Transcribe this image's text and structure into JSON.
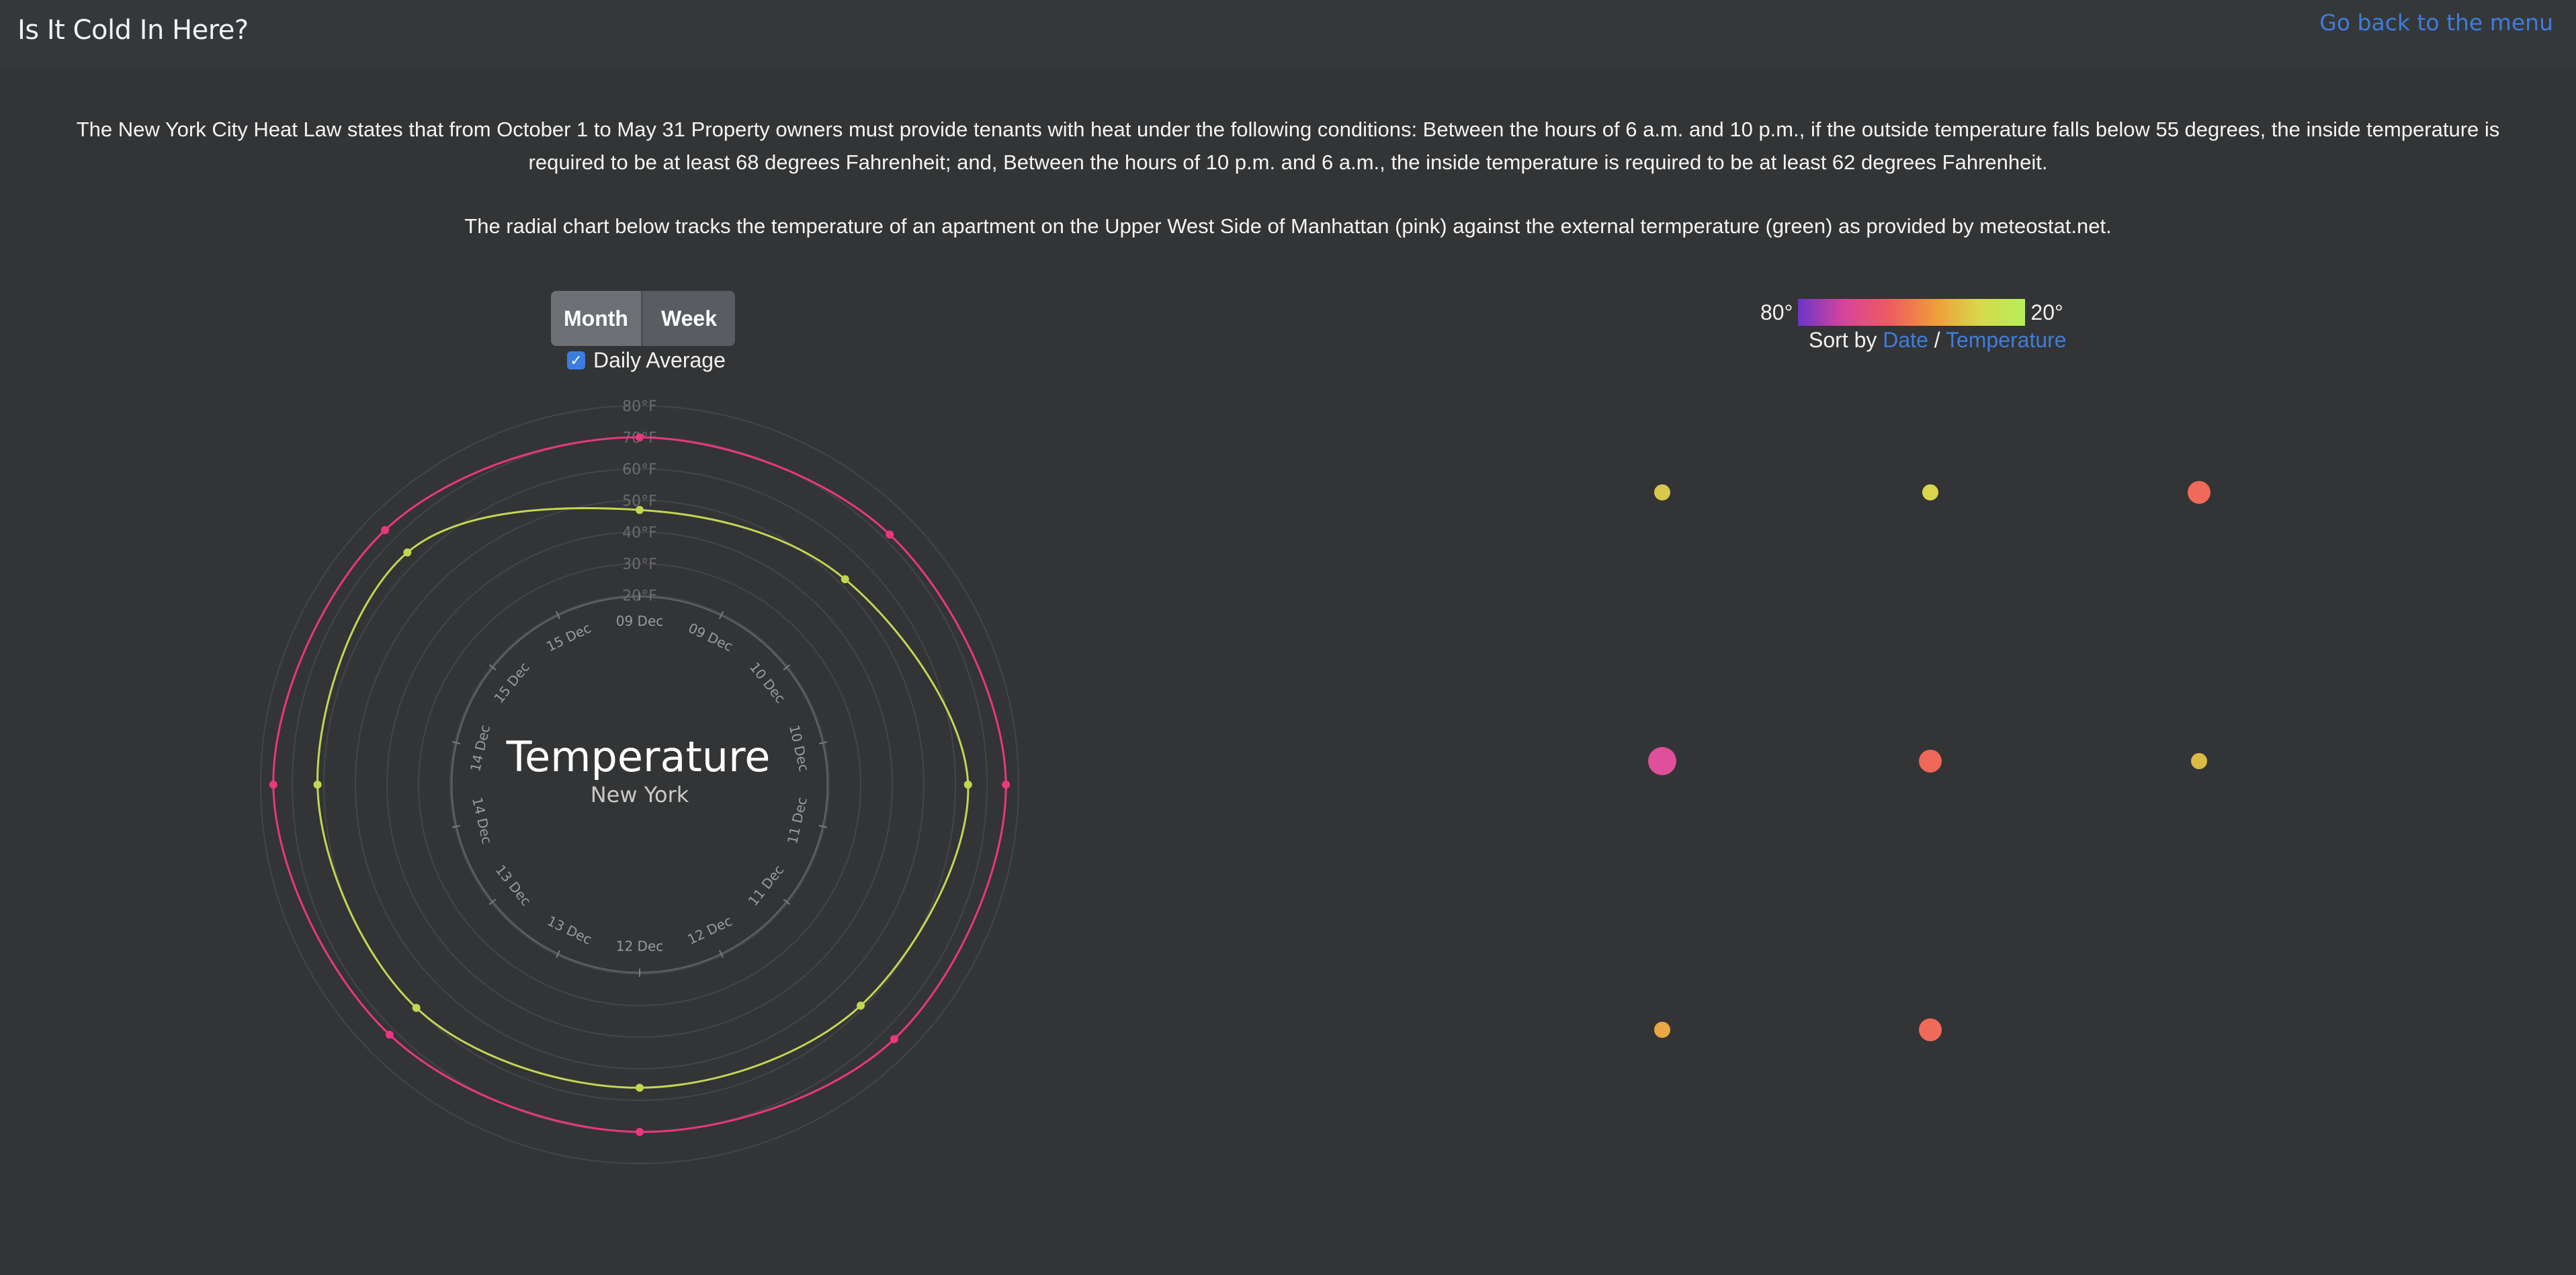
{
  "header": {
    "title": "Is It Cold In Here?",
    "back_link": "Go back to the menu"
  },
  "intro": {
    "paragraph1": "The New York City Heat Law states that from October 1 to May 31 Property owners must provide tenants with heat under the following conditions: Between the hours of 6 a.m. and 10 p.m., if the outside temperature falls below 55 degrees, the inside temperature is required to be at least 68 degrees Fahrenheit; and, Between the hours of 10 p.m. and 6 a.m., the inside temperature is required to be at least 62 degrees Fahrenheit.",
    "paragraph2": "The radial chart below tracks the temperature of an apartment on the Upper West Side of Manhattan (pink) against the external termperature (green) as provided by meteostat.net."
  },
  "controls": {
    "month_label": "Month",
    "week_label": "Week",
    "daily_average_label": "Daily Average",
    "daily_average_checked": true
  },
  "legend": {
    "low_label": "80°",
    "high_label": "20°",
    "sort_prefix": "Sort by",
    "sort_date": "Date",
    "sort_separator": "/",
    "sort_temperature": "Temperature"
  },
  "chart_data": [
    {
      "type": "radial-line",
      "title": "Temperature",
      "subtitle": "New York",
      "radial_ticks": [
        "20°F",
        "30°F",
        "40°F",
        "50°F",
        "60°F",
        "70°F",
        "80°F"
      ],
      "radial_tick_values": [
        20,
        30,
        40,
        50,
        60,
        70,
        80
      ],
      "angle_labels": [
        "09 Dec",
        "09 Dec",
        "10 Dec",
        "10 Dec",
        "11 Dec",
        "11 Dec",
        "12 Dec",
        "12 Dec",
        "13 Dec",
        "13 Dec",
        "14 Dec",
        "14 Dec",
        "15 Dec",
        "15 Dec"
      ],
      "grid": true,
      "series": [
        {
          "name": "inside",
          "color": "#e8387f",
          "points": [
            {
              "date": "09 Dec",
              "temp": 70
            },
            {
              "date": "09 Dec",
              "temp": 72
            },
            {
              "date": "10 Dec",
              "temp": 76
            },
            {
              "date": "11 Dec",
              "temp": 74
            },
            {
              "date": "12 Dec",
              "temp": 70
            },
            {
              "date": "13 Dec",
              "temp": 72
            },
            {
              "date": "14 Dec",
              "temp": 76
            },
            {
              "date": "15 Dec",
              "temp": 74
            }
          ]
        },
        {
          "name": "outside",
          "color": "#c3d653",
          "points": [
            {
              "date": "09 Dec",
              "temp": 47
            },
            {
              "date": "09 Dec",
              "temp": 52
            },
            {
              "date": "10 Dec",
              "temp": 64
            },
            {
              "date": "11 Dec",
              "temp": 59
            },
            {
              "date": "12 Dec",
              "temp": 56
            },
            {
              "date": "13 Dec",
              "temp": 60
            },
            {
              "date": "14 Dec",
              "temp": 62
            },
            {
              "date": "15 Dec",
              "temp": 64
            }
          ]
        }
      ]
    },
    {
      "type": "scatter",
      "dots": [
        {
          "color": "#d8c94d",
          "size": "small"
        },
        {
          "color": "#d9d64c",
          "size": "small"
        },
        {
          "color": "#ef6a5a",
          "size": "medium"
        },
        {
          "color": "#df4f9a",
          "size": "large"
        },
        {
          "color": "#ee6758",
          "size": "medium"
        },
        {
          "color": "#dcbb45",
          "size": "small"
        },
        {
          "color": "#e9a843",
          "size": "small"
        },
        {
          "color": "#ef6a59",
          "size": "medium"
        }
      ]
    }
  ]
}
